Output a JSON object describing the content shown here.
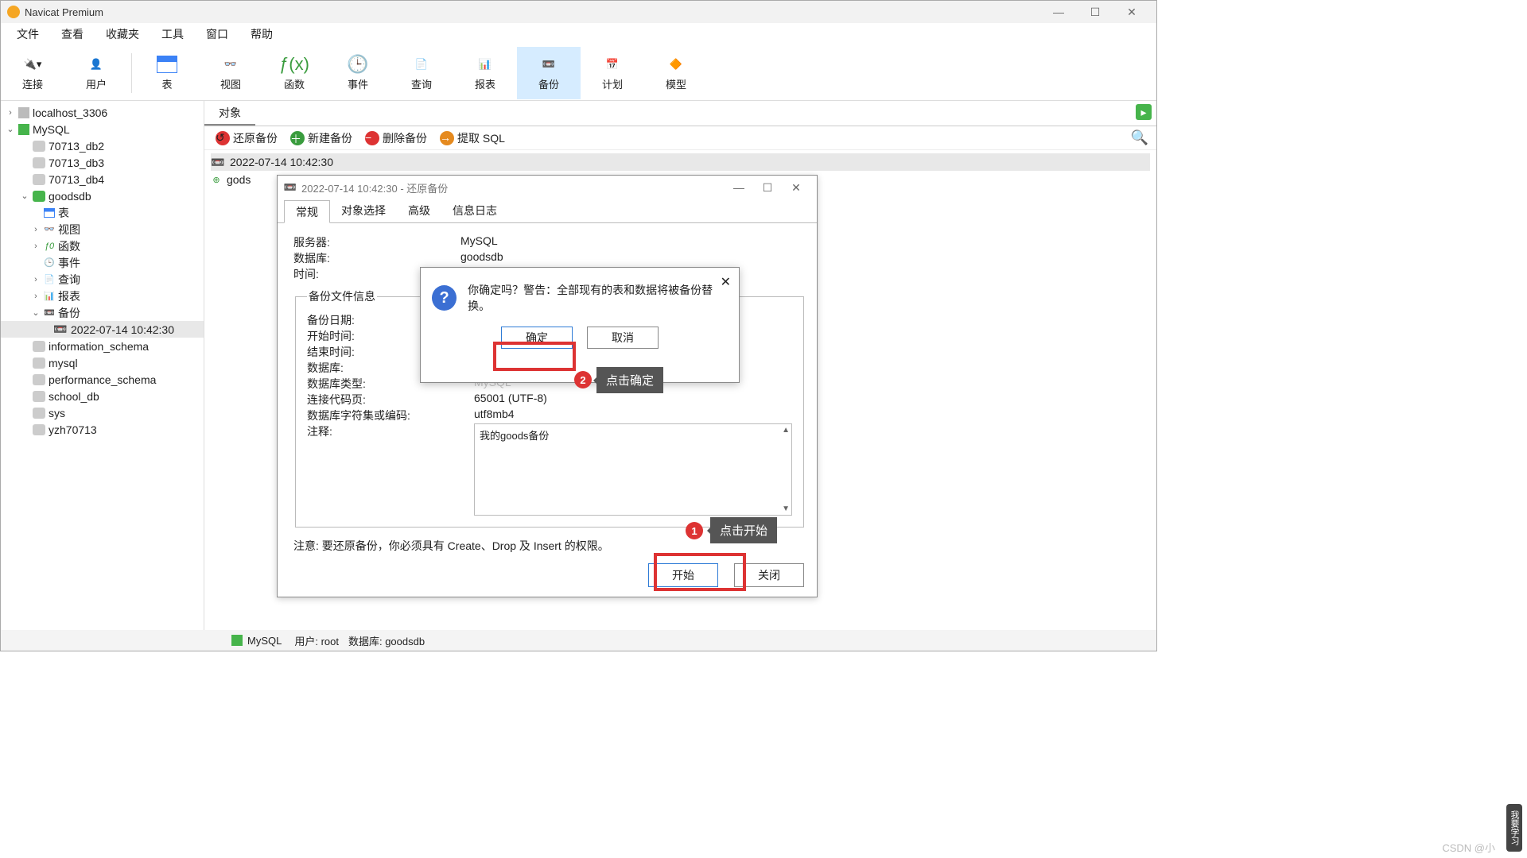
{
  "titlebar": {
    "app_name": "Navicat Premium"
  },
  "menubar": [
    "文件",
    "查看",
    "收藏夹",
    "工具",
    "窗口",
    "帮助"
  ],
  "toolbar": {
    "connect": "连接",
    "user": "用户",
    "table": "表",
    "view": "视图",
    "func": "函数",
    "event": "事件",
    "query": "查询",
    "report": "报表",
    "backup": "备份",
    "plan": "计划",
    "model": "模型"
  },
  "tree": {
    "localhost": "localhost_3306",
    "mysql_conn": "MySQL",
    "db2": "70713_db2",
    "db3": "70713_db3",
    "db4": "70713_db4",
    "goodsdb": "goodsdb",
    "goods_children": {
      "table": "表",
      "view": "视图",
      "func": "函数",
      "event": "事件",
      "query": "查询",
      "report": "报表",
      "backup": "备份",
      "backup_item": "2022-07-14 10:42:30"
    },
    "info_schema": "information_schema",
    "mysql_db": "mysql",
    "perf_schema": "performance_schema",
    "school_db": "school_db",
    "sys": "sys",
    "yzh": "yzh70713"
  },
  "obj_tab": "对象",
  "actionbar": {
    "restore": "还原备份",
    "new": "新建备份",
    "delete": "删除备份",
    "extract": "提取 SQL"
  },
  "list": {
    "row1": "2022-07-14 10:42:30",
    "row2": "gods"
  },
  "dlg1": {
    "title": "2022-07-14 10:42:30 - 还原备份",
    "tabs": {
      "general": "常规",
      "objsel": "对象选择",
      "adv": "高级",
      "log": "信息日志"
    },
    "labels": {
      "server": "服务器:",
      "database": "数据库:",
      "time": "时间:",
      "fs_legend": "备份文件信息",
      "backup_date": "备份日期:",
      "start": "开始时间:",
      "end": "结束时间:",
      "db": "数据库:",
      "dbtype": "数据库类型:",
      "codepage": "连接代码页:",
      "charset": "数据库字符集或编码:",
      "comment": "注释:"
    },
    "values": {
      "server": "MySQL",
      "database": "goodsdb",
      "dbtype_hint": "MySQL",
      "codepage": "65001 (UTF-8)",
      "charset": "utf8mb4",
      "comment": "我的goods备份"
    },
    "note": "注意: 要还原备份，你必须具有 Create、Drop 及 Insert 的权限。",
    "btn_start": "开始",
    "btn_close": "关闭"
  },
  "dlg2": {
    "text": "你确定吗？警告：全部现有的表和数据将被备份替换。",
    "ok": "确定",
    "cancel": "取消"
  },
  "annot": {
    "tip1": "点击开始",
    "tip2": "点击确定",
    "badge1": "1",
    "badge2": "2"
  },
  "status": {
    "conn": "MySQL",
    "user_label": "用户: root",
    "db_label": "数据库: goodsdb"
  },
  "watermark": "CSDN @小",
  "scrolltab": "我要学习"
}
